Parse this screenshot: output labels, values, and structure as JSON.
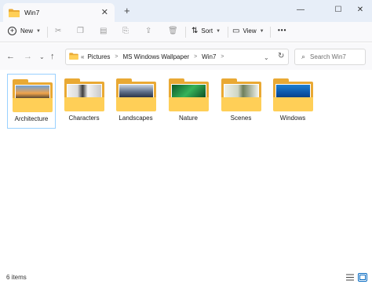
{
  "window": {
    "tab_title": "Win7",
    "new_tab_symbol": "+",
    "close_tab_symbol": "✕",
    "minimize_symbol": "—",
    "maximize_symbol": "☐",
    "close_symbol": "✕"
  },
  "toolbar": {
    "new_label": "New",
    "sort_label": "Sort",
    "view_label": "View",
    "more_label": "•••"
  },
  "address": {
    "overflow_label": "«",
    "crumbs": [
      "Pictures",
      "MS Windows Wallpaper",
      "Win7"
    ],
    "search_placeholder": "Search Win7"
  },
  "items": [
    {
      "label": "Architecture",
      "selected": true
    },
    {
      "label": "Characters",
      "selected": false
    },
    {
      "label": "Landscapes",
      "selected": false
    },
    {
      "label": "Nature",
      "selected": false
    },
    {
      "label": "Scenes",
      "selected": false
    },
    {
      "label": "Windows",
      "selected": false
    }
  ],
  "status": {
    "count_text": "6 items"
  },
  "colors": {
    "accent": "#0067c0",
    "folder_back": "#e9a934",
    "folder_front": "#ffcf57",
    "selection_border": "#99d1ff"
  }
}
